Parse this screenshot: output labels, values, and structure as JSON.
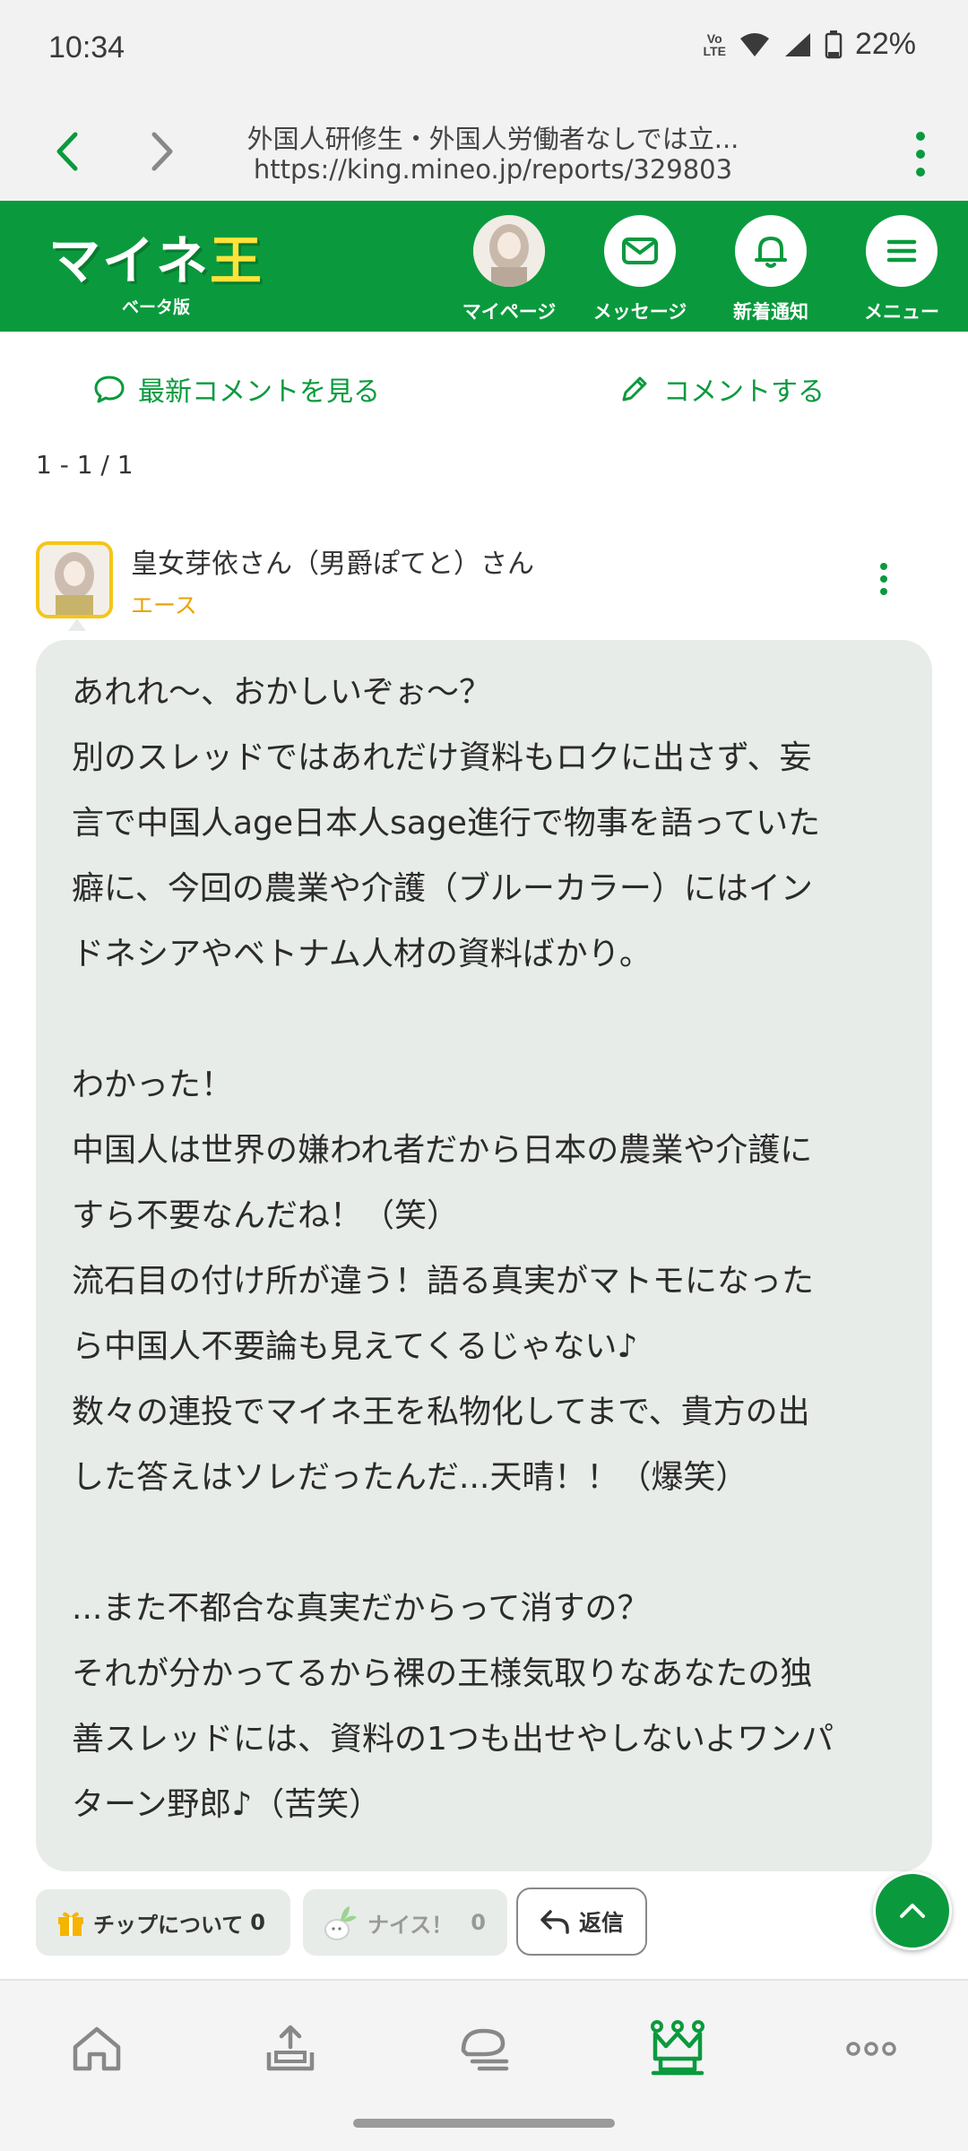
{
  "status": {
    "time": "10:34",
    "volte_top": "Vo",
    "volte_bottom": "LTE",
    "battery": "22%"
  },
  "browser": {
    "title": "外国人研修生・外国人労働者なしでは立...",
    "url": "https://king.mineo.jp/reports/329803"
  },
  "header": {
    "logo_main": "マイネ",
    "logo_accent": "王",
    "logo_sub": "ベータ版",
    "nav": [
      {
        "label": "マイページ",
        "icon": "avatar"
      },
      {
        "label": "メッセージ",
        "icon": "mail-icon"
      },
      {
        "label": "新着通知",
        "icon": "bell-icon"
      },
      {
        "label": "メニュー",
        "icon": "hamburger-icon"
      }
    ]
  },
  "actions": {
    "latest": "最新コメントを見る",
    "comment": "コメントする"
  },
  "pager": "1 - 1 / 1",
  "comment": {
    "user": "皇女芽依さん（男爵ぽてと）さん",
    "rank": "エース",
    "lines": [
      "あれれ〜、おかしいぞぉ〜？",
      "別のスレッドではあれだけ資料もロクに出さず、妄",
      "言で中国人age日本人sage進行で物事を語っていた",
      "癖に、今回の農業や介護（ブルーカラー）にはイン",
      "ドネシアやベトナム人材の資料ばかり。",
      "",
      "わかった！",
      "中国人は世界の嫌われ者だから日本の農業や介護に",
      "すら不要なんだね！（笑）",
      "流石目の付け所が違う！語る真実がマトモになった",
      "ら中国人不要論も見えてくるじゃない♪",
      "数々の連投でマイネ王を私物化してまで、貴方の出",
      "した答えはソレだったんだ...天晴！！（爆笑）",
      "",
      "...また不都合な真実だからって消すの？",
      "それが分かってるから裸の王様気取りなあなたの独",
      "善スレッドには、資料の1つも出せやしないよワンパ",
      "ターン野郎♪（苦笑）"
    ]
  },
  "buttons": {
    "chip": "チップについて",
    "chip_count": "0",
    "nice": "ナイス！",
    "nice_count": "0",
    "reply": "返信"
  },
  "colors": {
    "brand_green": "#0a9a3d",
    "rank_gold": "#e8a300",
    "bubble_bg": "#e8ece9"
  },
  "bottom_nav": [
    "home-icon",
    "upload-icon",
    "chat-icon",
    "crown-icon",
    "more-icon"
  ]
}
